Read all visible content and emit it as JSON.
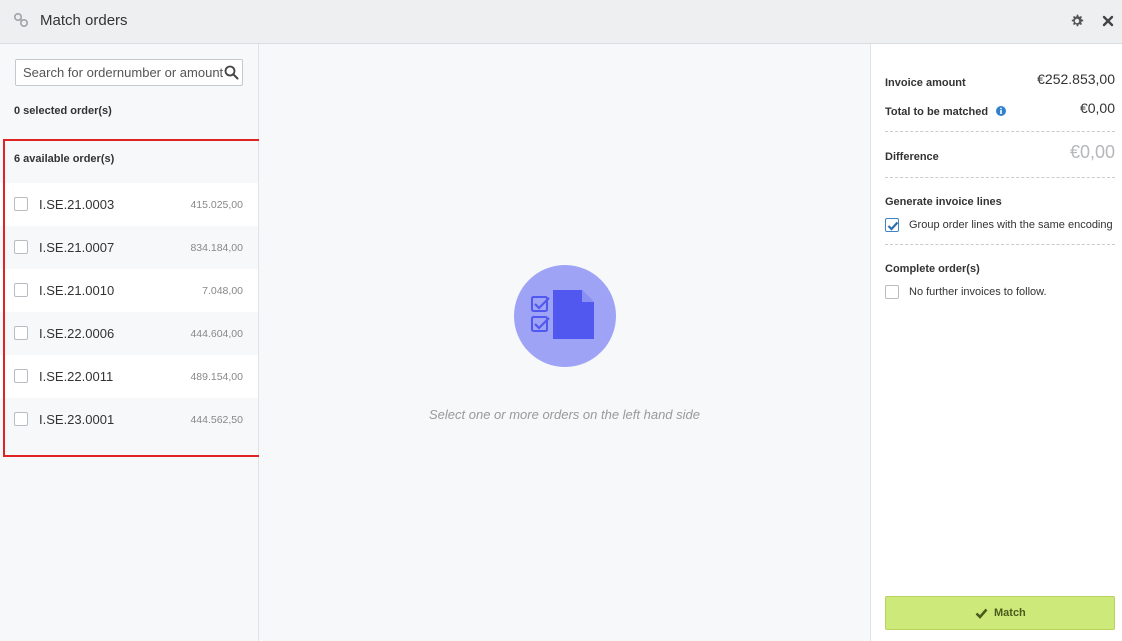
{
  "window": {
    "title": "Match orders",
    "icons": [
      "link-icon",
      "gear-icon",
      "close-icon"
    ]
  },
  "left": {
    "search_placeholder": "Search for ordernumber or amount",
    "selected_count": "0 selected order(s)",
    "available_count": "6 available order(s)",
    "orders": [
      {
        "id": "I.SE.21.0003",
        "amount": "415.025,00"
      },
      {
        "id": "I.SE.21.0007",
        "amount": "834.184,00"
      },
      {
        "id": "I.SE.21.0010",
        "amount": "7.048,00"
      },
      {
        "id": "I.SE.22.0006",
        "amount": "444.604,00"
      },
      {
        "id": "I.SE.22.0011",
        "amount": "489.154,00"
      },
      {
        "id": "I.SE.23.0001",
        "amount": "444.562,50"
      }
    ]
  },
  "center": {
    "empty_message": "Select one or more orders on the left hand side",
    "illustration_icon": "document-checklist-icon"
  },
  "right": {
    "invoice_amount_label": "Invoice amount",
    "invoice_amount_value": "€252.853,00",
    "total_matched_label": "Total to be matched",
    "total_matched_value": "€0,00",
    "difference_label": "Difference",
    "difference_value": "€0,00",
    "generate_lines_label": "Generate invoice lines",
    "group_lines_label": "Group order lines with the same encoding",
    "group_lines_checked": true,
    "complete_orders_label": "Complete order(s)",
    "no_further_label": "No further invoices to follow.",
    "no_further_checked": false,
    "match_button_label": "Match"
  },
  "colors": {
    "accent_blue": "#3d84c4",
    "match_button": "#cde97a",
    "illustration_circle": "#9ea3f5",
    "illustration_doc": "#5058f0",
    "highlight_red": "#e02424"
  }
}
